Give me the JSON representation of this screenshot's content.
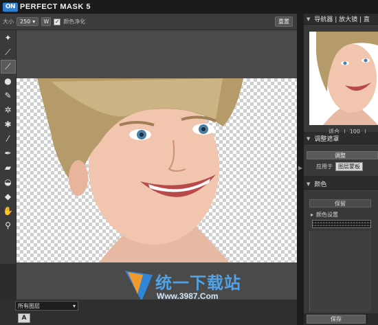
{
  "app": {
    "logo_text": "ON",
    "title": "PERFECT MASK 5"
  },
  "options": {
    "size_label": "大小",
    "size_value": "250",
    "width_btn": "W",
    "checkbox_checked": "✓",
    "clean_color_label": "颜色净化",
    "reset_label": "重置"
  },
  "tools": [
    "magic-brush-icon",
    "brush-icon",
    "brush-icon",
    "mask-brush-icon",
    "brush-icon",
    "bucket-icon",
    "chisel-icon",
    "eyedropper-icon",
    "pen-icon",
    "eraser-icon",
    "drop-icon",
    "fill-icon",
    "hand-icon",
    "zoom-icon"
  ],
  "bottom": {
    "layer_select": "所有图层",
    "layer_select_arrow": "▾",
    "a_button": "A"
  },
  "navigator": {
    "tabs": "导航器 | 放大镜 | 直",
    "fit_label": "适合",
    "zoom_value": "100"
  },
  "adjust": {
    "header": "调整遮罩",
    "adjust_button": "调整",
    "apply_to_label": "应用于",
    "apply_to_value": "图层蒙板"
  },
  "color": {
    "header": "颜色",
    "keep_label": "保留",
    "color_settings_label": "颜色设置"
  },
  "save_label": "保存",
  "watermark": {
    "text": "统一下载站",
    "url": "Www.3987.Com"
  }
}
